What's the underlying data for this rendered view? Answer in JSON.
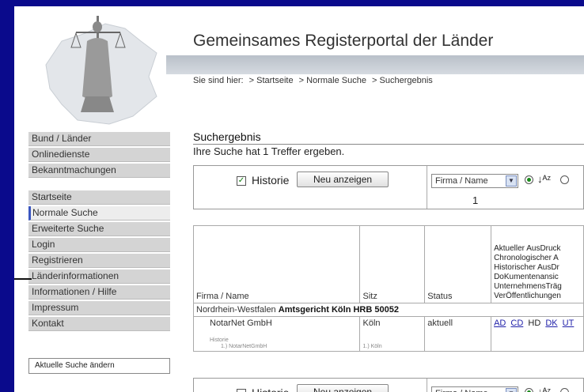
{
  "header": {
    "title": "Gemeinsames Registerportal der Länder",
    "breadcrumb_prefix": "Sie sind hier:",
    "breadcrumb": [
      "> Startseite",
      "> Normale Suche",
      "> Suchergebnis"
    ]
  },
  "sidebar": {
    "group1": [
      "Bund / Länder",
      "Onlinedienste",
      "Bekanntmachungen"
    ],
    "group2": [
      "Startseite",
      "Normale Suche",
      "Erweiterte Suche",
      "Login",
      "Registrieren",
      "Länderinformationen",
      "Informationen / Hilfe",
      "Impressum",
      "Kontakt"
    ],
    "active": "Normale Suche",
    "change_search_button": "Aktuelle Suche ändern"
  },
  "main": {
    "heading": "Suchergebnis",
    "hits_text": "Ihre Suche hat 1 Treffer ergeben.",
    "toolbar": {
      "historie_label": "Historie",
      "historie_checked": true,
      "show_button": "Neu anzeigen",
      "sort_select_value": "Firma / Name",
      "page": "1"
    },
    "table": {
      "columns": [
        "Firma / Name",
        "Sitz",
        "Status"
      ],
      "doc_types": [
        "Aktueller AusDruck",
        "Chronologischer A",
        "Historischer AusDr",
        "DoKumentenansic",
        "UnternehmensTräg",
        "VerÖffentlichungen"
      ],
      "court_prefix": "Nordrhein-Westfalen",
      "court_bold": "Amtsgericht Köln HRB 50052",
      "entry": {
        "name": "NotarNet GmbH",
        "sitz": "Köln",
        "status": "aktuell",
        "history_label": "Historie",
        "history_name": "1.) NotarNetGmbH",
        "history_sitz": "1.) Köln",
        "links": [
          "AD",
          "CD",
          "HD",
          "DK",
          "UT"
        ]
      }
    }
  },
  "colors": {
    "frame_background": "#0a0a8c",
    "nav_item": "#d4d4d4",
    "active_marker": "#3a56c0",
    "link": "#2222aa"
  }
}
